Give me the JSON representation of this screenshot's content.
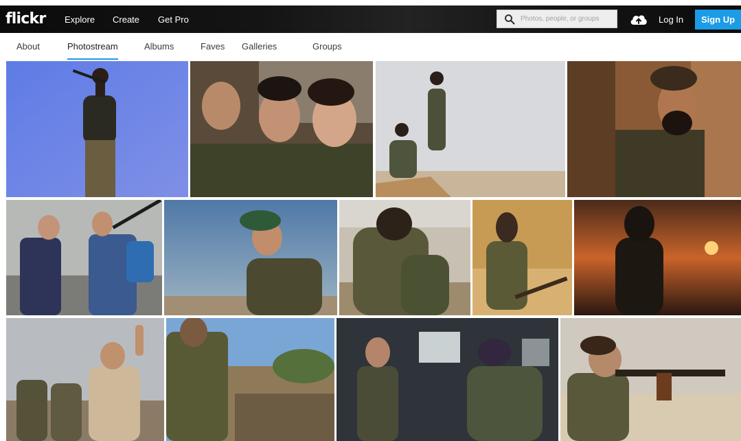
{
  "header": {
    "logo": "flickr",
    "nav": [
      "Explore",
      "Create",
      "Get Pro"
    ],
    "search_placeholder": "Photos, people, or groups",
    "login_label": "Log In",
    "signup_label": "Sign Up"
  },
  "subnav": {
    "tabs": [
      "About",
      "Photostream",
      "Albums",
      "Faves",
      "Galleries",
      "Groups"
    ],
    "active": "Photostream"
  },
  "colors": {
    "accent": "#1c9be6",
    "topbar": "#111111"
  },
  "icons": {
    "search": "search-icon",
    "upload": "cloud-upload-icon"
  },
  "photos": {
    "rows": 3,
    "row1_count": 4,
    "row2_count": 5,
    "row3_count": 4
  }
}
